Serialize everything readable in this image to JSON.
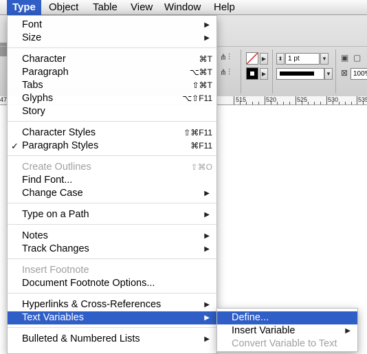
{
  "menubar": {
    "items": [
      "Type",
      "Object",
      "Table",
      "View",
      "Window",
      "Help"
    ]
  },
  "toolbar": {
    "stroke_weight": "1 pt",
    "zoom": "100%"
  },
  "ruler": {
    "labels": [
      "47",
      "515",
      "520",
      "525",
      "530",
      "535"
    ]
  },
  "type_menu": {
    "items": [
      {
        "label": "Font",
        "submenu": true
      },
      {
        "label": "Size",
        "submenu": true
      },
      {
        "label": "Character",
        "shortcut": "⌘T"
      },
      {
        "label": "Paragraph",
        "shortcut": "⌥⌘T"
      },
      {
        "label": "Tabs",
        "shortcut": "⇧⌘T"
      },
      {
        "label": "Glyphs",
        "shortcut": "⌥⇧F11"
      },
      {
        "label": "Story"
      },
      {
        "label": "Character Styles",
        "shortcut": "⇧⌘F11"
      },
      {
        "label": "Paragraph Styles",
        "shortcut": "⌘F11",
        "checked": true
      },
      {
        "label": "Create Outlines",
        "shortcut": "⇧⌘O",
        "disabled": true
      },
      {
        "label": "Find Font..."
      },
      {
        "label": "Change Case",
        "submenu": true
      },
      {
        "label": "Type on a Path",
        "submenu": true
      },
      {
        "label": "Notes",
        "submenu": true
      },
      {
        "label": "Track Changes",
        "submenu": true
      },
      {
        "label": "Insert Footnote",
        "disabled": true
      },
      {
        "label": "Document Footnote Options..."
      },
      {
        "label": "Hyperlinks & Cross-References",
        "submenu": true
      },
      {
        "label": "Text Variables",
        "submenu": true,
        "active": true
      },
      {
        "label": "Bulleted & Numbered Lists",
        "submenu": true
      }
    ],
    "check_glyph": "✓",
    "arrow_glyph": "▶"
  },
  "text_variables_submenu": {
    "items": [
      {
        "label": "Define...",
        "active": true
      },
      {
        "label": "Insert Variable",
        "submenu": true
      },
      {
        "label": "Convert Variable to Text",
        "disabled": true
      }
    ]
  },
  "colors": {
    "highlight": "#2f5ec6",
    "disabled_text": "#a0a0a0"
  }
}
